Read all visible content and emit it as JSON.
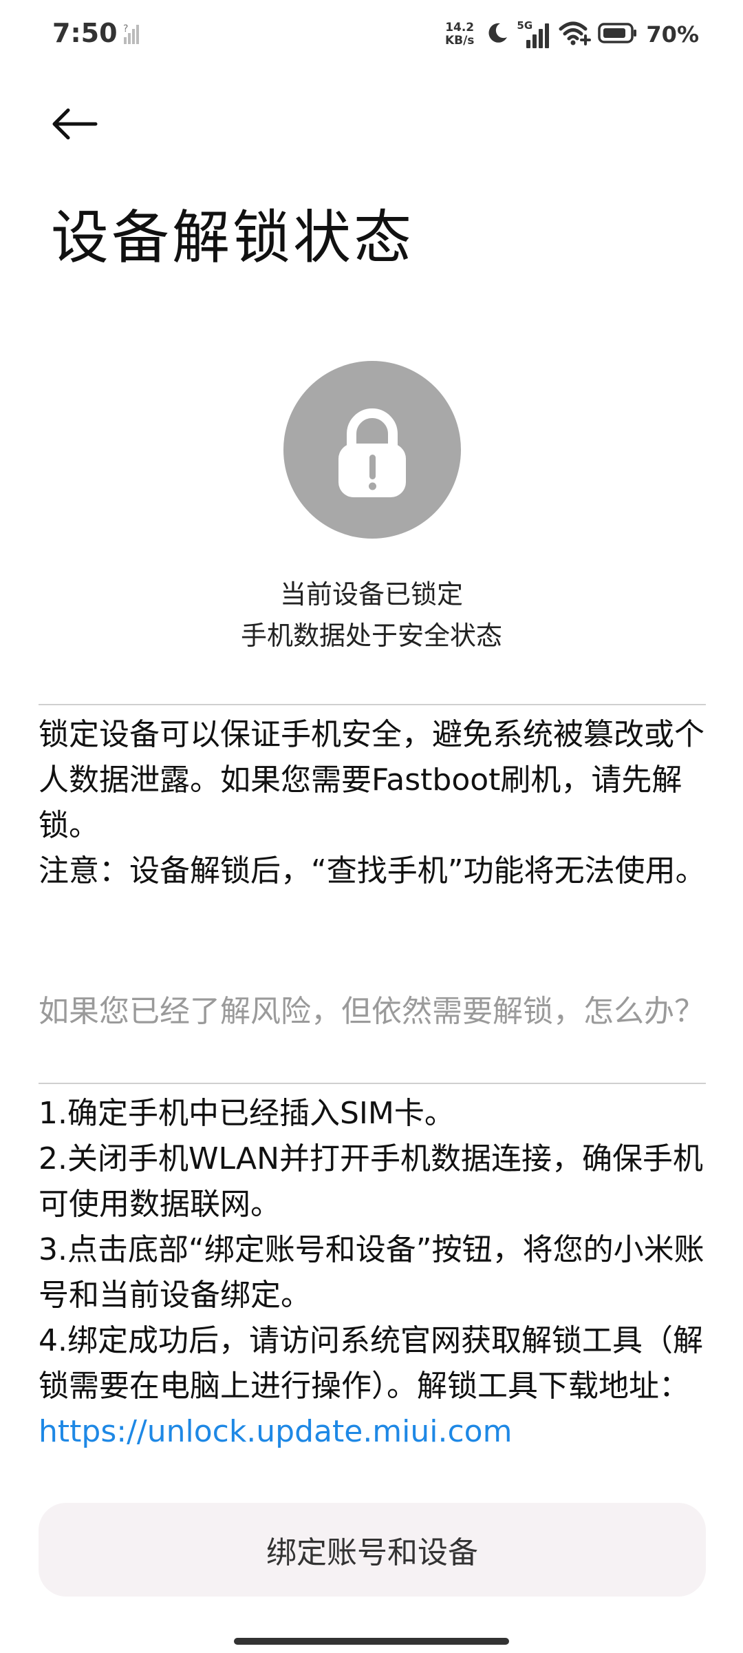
{
  "status_bar": {
    "time": "7:50",
    "net_speed_value": "14.2",
    "net_speed_unit": "KB/s",
    "network_type": "5G",
    "battery_percent": "70%"
  },
  "header": {
    "title": "设备解锁状态"
  },
  "lock_status": {
    "line1": "当前设备已锁定",
    "line2": "手机数据处于安全状态"
  },
  "description": {
    "paragraph1": "锁定设备可以保证手机安全，避免系统被篡改或个人数据泄露。如果您需要Fastboot刷机，请先解锁。",
    "paragraph2": "注意：设备解锁后，“查找手机”功能将无法使用。"
  },
  "faq": {
    "question": "如果您已经了解风险，但依然需要解锁，怎么办？",
    "steps": [
      "1.确定手机中已经插入SIM卡。",
      "2.关闭手机WLAN并打开手机数据连接，确保手机可使用数据联网。",
      "3.点击底部“绑定账号和设备”按钮，将您的小米账号和当前设备绑定。",
      "4.绑定成功后，请访问系统官网获取解锁工具（解锁需要在电脑上进行操作）。解锁工具下载地址："
    ],
    "link_text": "https://unlock.update.miui.com"
  },
  "actions": {
    "bind_label": "绑定账号和设备"
  },
  "colors": {
    "link": "#1e88e5",
    "lock_circle": "#a8a8a8",
    "button_bg": "#f6f2f4"
  }
}
